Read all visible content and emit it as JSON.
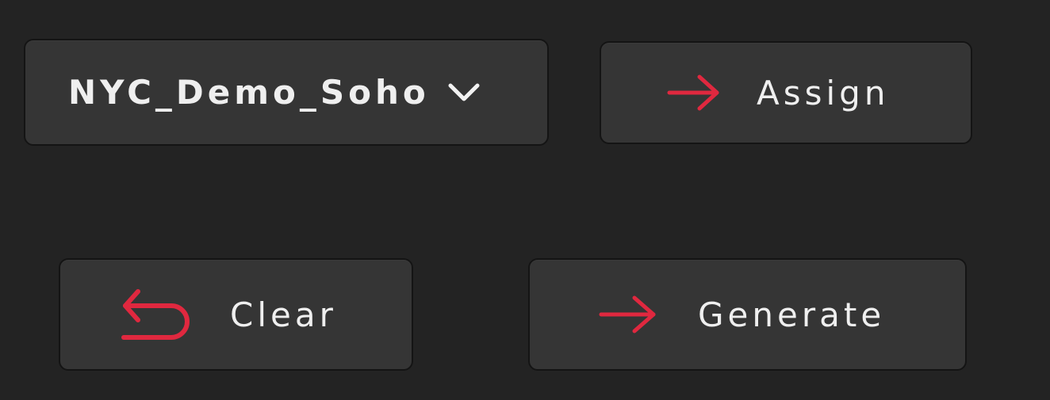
{
  "accent_color": "#e0283f",
  "dropdown": {
    "selected": "NYC_Demo_Soho",
    "icon": "chevron-down-icon"
  },
  "assign_button": {
    "label": "Assign",
    "icon": "arrow-right-icon"
  },
  "clear_button": {
    "label": "Clear",
    "icon": "undo-icon"
  },
  "generate_button": {
    "label": "Generate",
    "icon": "arrow-right-icon"
  }
}
